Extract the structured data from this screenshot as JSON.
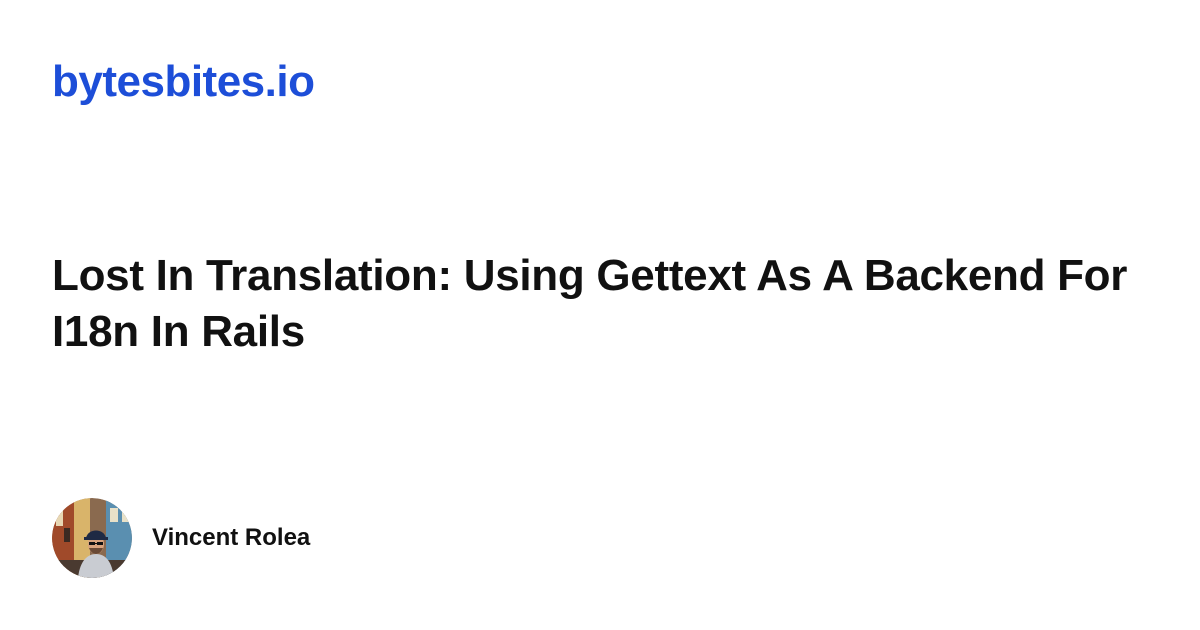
{
  "site": {
    "name": "bytesbites.io",
    "brand_color": "#1d4ed8"
  },
  "article": {
    "title": "Lost In Translation: Using Gettext As A Backend For I18n In Rails"
  },
  "author": {
    "name": "Vincent Rolea",
    "avatar_icon": "author-avatar-photo"
  }
}
